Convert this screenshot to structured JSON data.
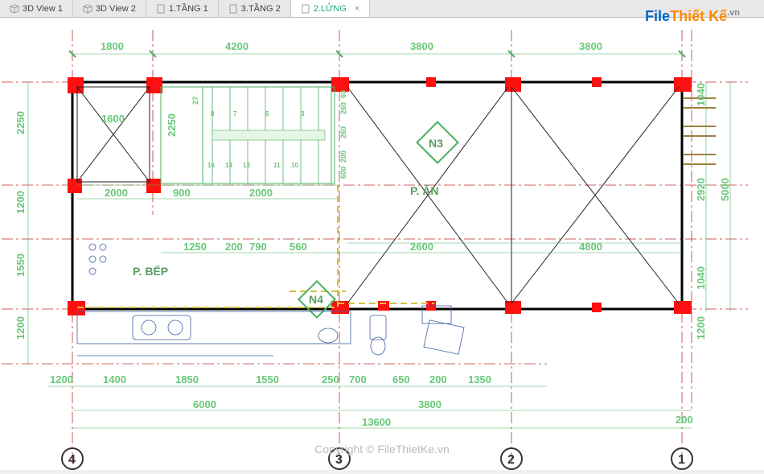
{
  "tabs": {
    "t1": "3D View 1",
    "t2": "3D View 2",
    "t3": "1.TẦNG 1",
    "t4": "3.TẦNG 2",
    "t5": "2.LỬNG"
  },
  "watermark": {
    "p1": "File",
    "p2": "Thiết Kế",
    "p3": ".vn"
  },
  "copyright": "Copyright © FileThietKe.vn",
  "rooms": {
    "bep": "P. BẾP",
    "an": "P. ĂN"
  },
  "markers": {
    "n3": "N3",
    "n4": "N4"
  },
  "axes": {
    "a1": "1",
    "a2": "2",
    "a3": "3",
    "a4": "4"
  },
  "dims": {
    "top_1": "1800",
    "top_2": "4200",
    "top_3": "3800",
    "top_4": "3800",
    "top_inner_1": "1600",
    "top_inner_2": "2250",
    "mid_1": "2000",
    "mid_2": "900",
    "mid_3": "2000",
    "wall_1": "1250",
    "wall_2": "200",
    "wall_3": "790",
    "wall_4": "560",
    "wall_5": "2600",
    "wall_6": "4800",
    "bot_1": "1200",
    "bot_2": "1400",
    "bot_3": "1850",
    "bot_4": "1550",
    "bot_5": "250",
    "bot_6": "700",
    "bot_7": "650",
    "bot_8": "200",
    "bot_9": "1350",
    "bot2_1": "6000",
    "bot2_2": "3800",
    "bot3_1": "13600",
    "bot3_2": "200",
    "left_1": "2250",
    "left_2": "1200",
    "left_3": "1550",
    "left_4": "1200",
    "right_1": "1040",
    "right_2": "2920",
    "right_3": "1040",
    "right_4": "5000",
    "right_5": "1200",
    "stair_small": [
      "27",
      "260",
      "260",
      "600",
      "200",
      "60"
    ],
    "stair_nums": [
      "8",
      "7",
      "5",
      "3",
      "16",
      "14",
      "13",
      "11",
      "10"
    ]
  }
}
